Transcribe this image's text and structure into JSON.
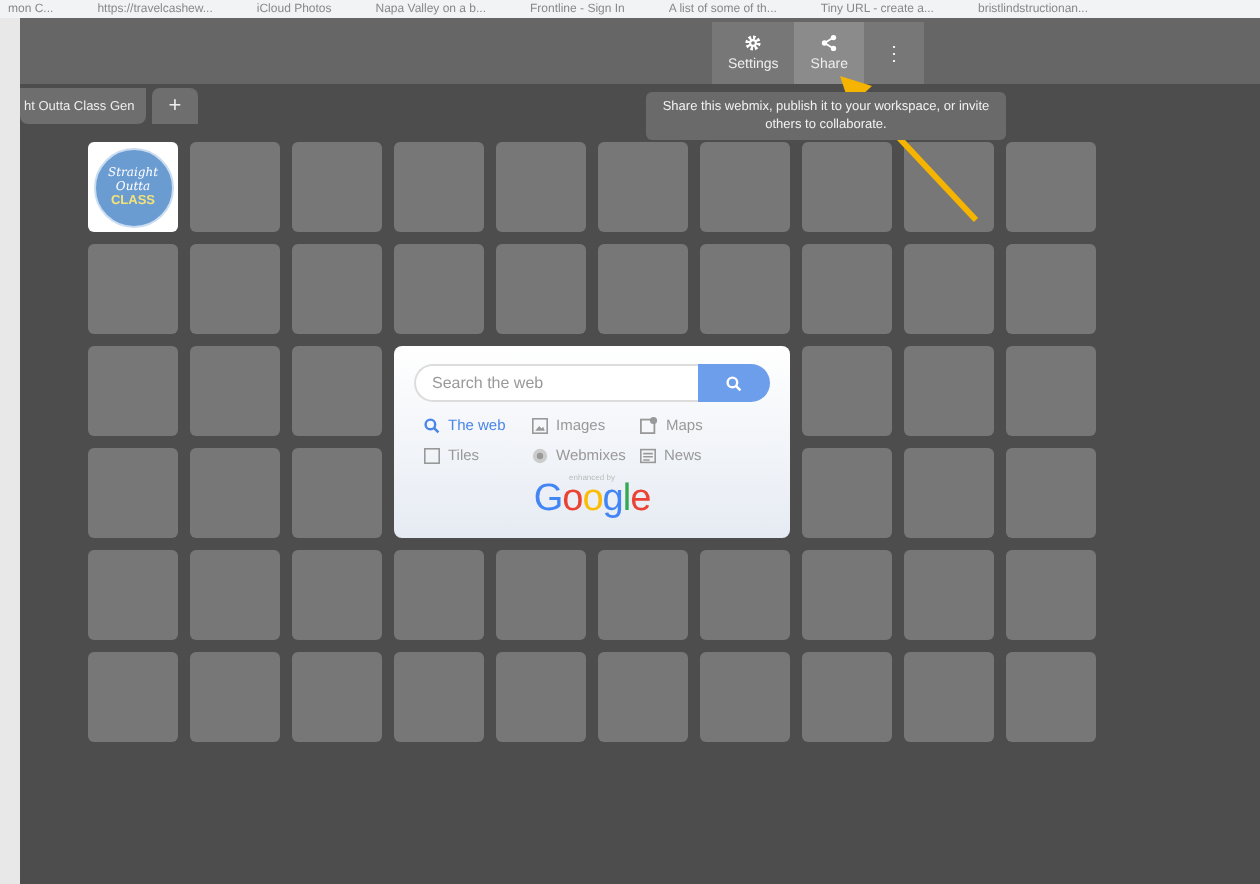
{
  "bookmarks": [
    "mon C...",
    "https://travelcashew...",
    "iCloud Photos",
    "Napa Valley on a b...",
    "Frontline - Sign In",
    "A list of some of th...",
    "Tiny URL - create a...",
    "bristlindstructionan..."
  ],
  "toolbar": {
    "buttons": [
      {
        "kind": "settings",
        "label": "Settings",
        "selected": false
      },
      {
        "kind": "share",
        "label": "Share",
        "selected": true
      },
      {
        "kind": "more",
        "label": "⋮",
        "selected": false
      }
    ]
  },
  "tooltip": "Share this webmix, publish it to your workspace, or invite others to collaborate.",
  "tabs": [
    {
      "label": "ht Outta Class Gen",
      "kind": "tab"
    },
    {
      "label": "+",
      "kind": "add"
    }
  ],
  "tiles": [
    {
      "kind": "logo",
      "lines": [
        "Straight",
        "Outta",
        "CLASS"
      ]
    }
  ],
  "search": {
    "placeholder": "Search the web",
    "options": [
      {
        "label": "The web",
        "kind": "search",
        "selected": true
      },
      {
        "label": "Images",
        "kind": "image",
        "selected": false
      },
      {
        "label": "Maps",
        "kind": "map",
        "selected": false
      },
      {
        "label": "Tiles",
        "kind": "tile",
        "selected": false
      },
      {
        "label": "Webmixes",
        "kind": "webmix",
        "selected": false
      },
      {
        "label": "News",
        "kind": "news",
        "selected": false
      }
    ],
    "credit": "enhanced by",
    "brand": "Google"
  }
}
